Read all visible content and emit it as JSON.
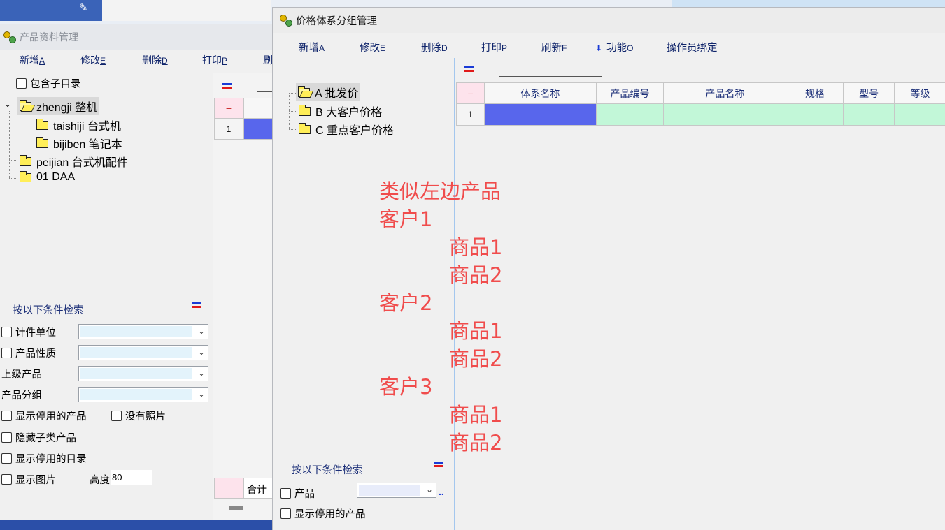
{
  "win1": {
    "title": "产品资料管理",
    "toolbar": {
      "new": "新增",
      "new_key": "A",
      "edit": "修改",
      "edit_key": "E",
      "delete": "删除",
      "delete_key": "D",
      "print": "打印",
      "print_key": "P",
      "refresh": "刷"
    },
    "include_children": "包含子目录",
    "tree": [
      "zhengji 整机",
      "taishiji 台式机",
      "bijiben 笔记本",
      "peijian 台式机配件",
      "01 DAA"
    ],
    "search_title": "按以下条件检索",
    "fields": {
      "unit": "计件单位",
      "nature": "产品性质",
      "parent": "上级产品",
      "group": "产品分组"
    },
    "options": {
      "show_disabled_products": "显示停用的产品",
      "no_photo": "没有照片",
      "hide_sub_products": "隐藏子类产品",
      "show_disabled_dirs": "显示停用的目录",
      "show_images": "显示图片",
      "height_label": "高度",
      "height_value": "80"
    },
    "grid": {
      "row1": "1",
      "total": "合计"
    }
  },
  "win2": {
    "title": "价格体系分组管理",
    "toolbar": {
      "new": "新增",
      "new_key": "A",
      "edit": "修改",
      "edit_key": "E",
      "delete": "删除",
      "delete_key": "D",
      "print": "打印",
      "print_key": "P",
      "refresh": "刷新",
      "refresh_key": "F",
      "function": "功能",
      "function_key": "O",
      "bind_operator": "操作员绑定"
    },
    "tree": [
      "A 批发价",
      "B 大客户价格",
      "C 重点客户价格"
    ],
    "table": {
      "columns": [
        "体系名称",
        "产品编号",
        "产品名称",
        "规格",
        "型号",
        "等级"
      ],
      "row1": "1"
    },
    "search_title": "按以下条件检索",
    "fields": {
      "product": "产品",
      "show_disabled_products": "显示停用的产品",
      "more": ".."
    }
  },
  "annotations": [
    "类似左边产品",
    "客户1",
    "商品1",
    "商品2",
    "客户2",
    "商品1",
    "商品2",
    "客户3",
    "商品1",
    "商品2"
  ],
  "colors": {
    "annotation": "#f04c4c",
    "selected_cell": "#5866ec",
    "row_fill": "#c2f7d8",
    "toolbar_text": "#10256b"
  }
}
